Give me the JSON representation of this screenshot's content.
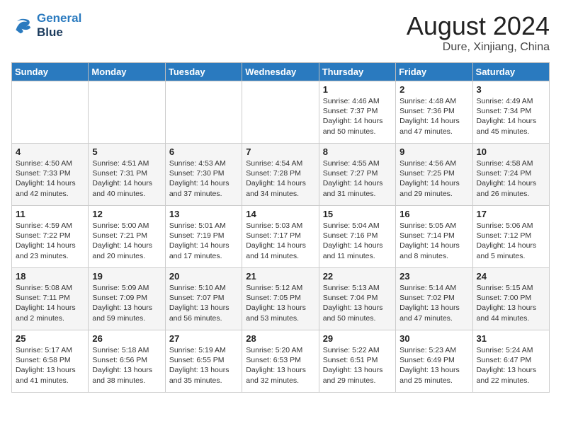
{
  "header": {
    "logo_line1": "General",
    "logo_line2": "Blue",
    "month_title": "August 2024",
    "location": "Dure, Xinjiang, China"
  },
  "weekdays": [
    "Sunday",
    "Monday",
    "Tuesday",
    "Wednesday",
    "Thursday",
    "Friday",
    "Saturday"
  ],
  "weeks": [
    [
      {
        "day": "",
        "info": ""
      },
      {
        "day": "",
        "info": ""
      },
      {
        "day": "",
        "info": ""
      },
      {
        "day": "",
        "info": ""
      },
      {
        "day": "1",
        "info": "Sunrise: 4:46 AM\nSunset: 7:37 PM\nDaylight: 14 hours and 50 minutes."
      },
      {
        "day": "2",
        "info": "Sunrise: 4:48 AM\nSunset: 7:36 PM\nDaylight: 14 hours and 47 minutes."
      },
      {
        "day": "3",
        "info": "Sunrise: 4:49 AM\nSunset: 7:34 PM\nDaylight: 14 hours and 45 minutes."
      }
    ],
    [
      {
        "day": "4",
        "info": "Sunrise: 4:50 AM\nSunset: 7:33 PM\nDaylight: 14 hours and 42 minutes."
      },
      {
        "day": "5",
        "info": "Sunrise: 4:51 AM\nSunset: 7:31 PM\nDaylight: 14 hours and 40 minutes."
      },
      {
        "day": "6",
        "info": "Sunrise: 4:53 AM\nSunset: 7:30 PM\nDaylight: 14 hours and 37 minutes."
      },
      {
        "day": "7",
        "info": "Sunrise: 4:54 AM\nSunset: 7:28 PM\nDaylight: 14 hours and 34 minutes."
      },
      {
        "day": "8",
        "info": "Sunrise: 4:55 AM\nSunset: 7:27 PM\nDaylight: 14 hours and 31 minutes."
      },
      {
        "day": "9",
        "info": "Sunrise: 4:56 AM\nSunset: 7:25 PM\nDaylight: 14 hours and 29 minutes."
      },
      {
        "day": "10",
        "info": "Sunrise: 4:58 AM\nSunset: 7:24 PM\nDaylight: 14 hours and 26 minutes."
      }
    ],
    [
      {
        "day": "11",
        "info": "Sunrise: 4:59 AM\nSunset: 7:22 PM\nDaylight: 14 hours and 23 minutes."
      },
      {
        "day": "12",
        "info": "Sunrise: 5:00 AM\nSunset: 7:21 PM\nDaylight: 14 hours and 20 minutes."
      },
      {
        "day": "13",
        "info": "Sunrise: 5:01 AM\nSunset: 7:19 PM\nDaylight: 14 hours and 17 minutes."
      },
      {
        "day": "14",
        "info": "Sunrise: 5:03 AM\nSunset: 7:17 PM\nDaylight: 14 hours and 14 minutes."
      },
      {
        "day": "15",
        "info": "Sunrise: 5:04 AM\nSunset: 7:16 PM\nDaylight: 14 hours and 11 minutes."
      },
      {
        "day": "16",
        "info": "Sunrise: 5:05 AM\nSunset: 7:14 PM\nDaylight: 14 hours and 8 minutes."
      },
      {
        "day": "17",
        "info": "Sunrise: 5:06 AM\nSunset: 7:12 PM\nDaylight: 14 hours and 5 minutes."
      }
    ],
    [
      {
        "day": "18",
        "info": "Sunrise: 5:08 AM\nSunset: 7:11 PM\nDaylight: 14 hours and 2 minutes."
      },
      {
        "day": "19",
        "info": "Sunrise: 5:09 AM\nSunset: 7:09 PM\nDaylight: 13 hours and 59 minutes."
      },
      {
        "day": "20",
        "info": "Sunrise: 5:10 AM\nSunset: 7:07 PM\nDaylight: 13 hours and 56 minutes."
      },
      {
        "day": "21",
        "info": "Sunrise: 5:12 AM\nSunset: 7:05 PM\nDaylight: 13 hours and 53 minutes."
      },
      {
        "day": "22",
        "info": "Sunrise: 5:13 AM\nSunset: 7:04 PM\nDaylight: 13 hours and 50 minutes."
      },
      {
        "day": "23",
        "info": "Sunrise: 5:14 AM\nSunset: 7:02 PM\nDaylight: 13 hours and 47 minutes."
      },
      {
        "day": "24",
        "info": "Sunrise: 5:15 AM\nSunset: 7:00 PM\nDaylight: 13 hours and 44 minutes."
      }
    ],
    [
      {
        "day": "25",
        "info": "Sunrise: 5:17 AM\nSunset: 6:58 PM\nDaylight: 13 hours and 41 minutes."
      },
      {
        "day": "26",
        "info": "Sunrise: 5:18 AM\nSunset: 6:56 PM\nDaylight: 13 hours and 38 minutes."
      },
      {
        "day": "27",
        "info": "Sunrise: 5:19 AM\nSunset: 6:55 PM\nDaylight: 13 hours and 35 minutes."
      },
      {
        "day": "28",
        "info": "Sunrise: 5:20 AM\nSunset: 6:53 PM\nDaylight: 13 hours and 32 minutes."
      },
      {
        "day": "29",
        "info": "Sunrise: 5:22 AM\nSunset: 6:51 PM\nDaylight: 13 hours and 29 minutes."
      },
      {
        "day": "30",
        "info": "Sunrise: 5:23 AM\nSunset: 6:49 PM\nDaylight: 13 hours and 25 minutes."
      },
      {
        "day": "31",
        "info": "Sunrise: 5:24 AM\nSunset: 6:47 PM\nDaylight: 13 hours and 22 minutes."
      }
    ]
  ]
}
